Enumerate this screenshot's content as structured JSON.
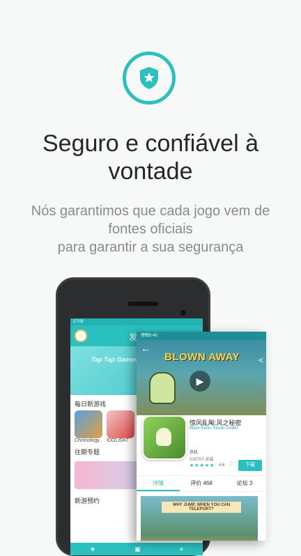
{
  "icon": "shield-star-icon",
  "colors": {
    "accent": "#2bbfbe",
    "title": "#262626",
    "subtitle": "#8a8a8a"
  },
  "title": "Seguro e confiável à vontade",
  "subtitle_lines": [
    "Nós garantimos que cada jogo vem de",
    "fontes oficiais",
    "para garantir a sua segurança"
  ],
  "phone_back": {
    "status_time": "17:05",
    "header_text": "发",
    "banner_text": "Tap Tap Games",
    "section_new_games": "每日新游戏",
    "games": [
      "Chronology...",
      "IDOLiSH7"
    ],
    "section_topics": "往期专题",
    "section_preorder": "新游预约"
  },
  "phone_front": {
    "status_time": "傍晚6:40",
    "game_banner_title": "BLOWN AWAY",
    "app_name": "惊风乱飐:风之秘密",
    "developer": "Black Pants Studio GmbH",
    "meta_line1": "热机",
    "meta_line2": "52875人安装",
    "stars": "★★★★★",
    "rating": "4.6",
    "download_label": "下载",
    "tabs": [
      "详情",
      "评价 468",
      "论坛 3"
    ],
    "screenshot_caption": "WHY JUMP, WHEN YOU CAN TELEPORT?"
  }
}
